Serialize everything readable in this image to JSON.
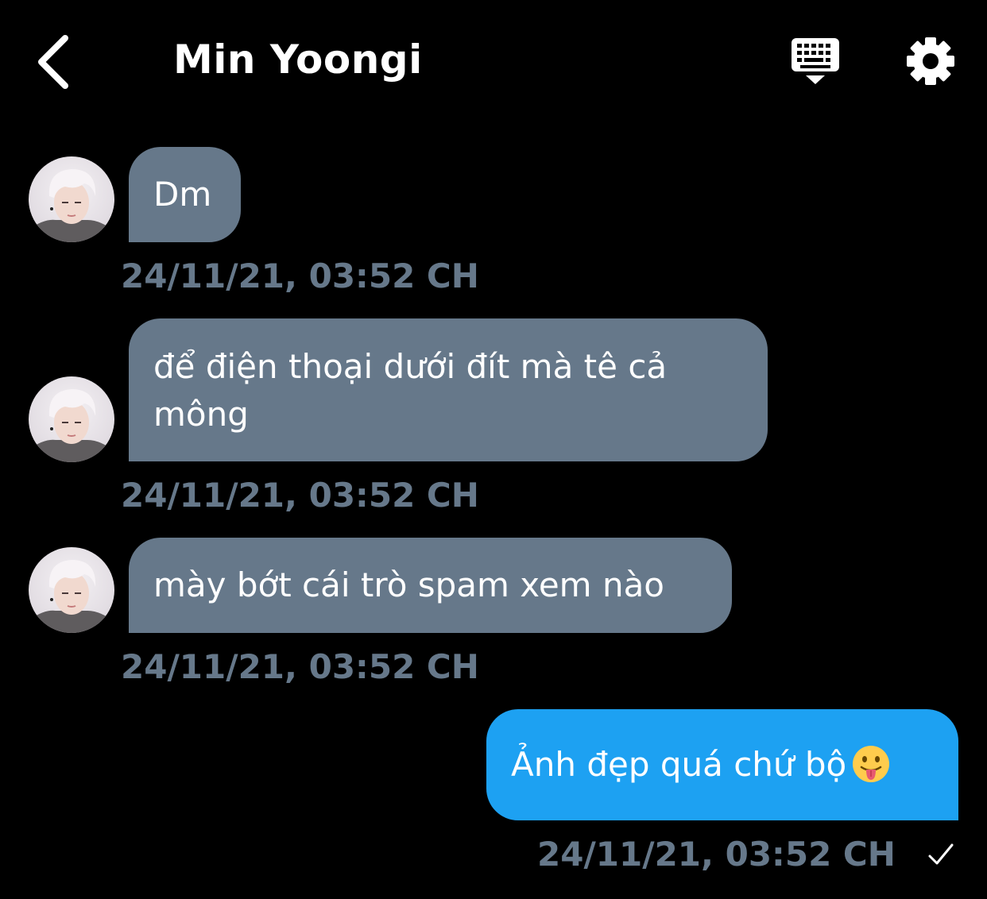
{
  "header": {
    "title": "Min Yoongi",
    "back_icon": "chevron-left-icon",
    "keyboard_icon": "keyboard-hide-icon",
    "settings_icon": "gear-icon"
  },
  "colors": {
    "background": "#000000",
    "incoming_bubble": "#66788a",
    "outgoing_bubble": "#1da1f2",
    "timestamp": "#66788a"
  },
  "messages": [
    {
      "direction": "incoming",
      "lines": [
        "Dm"
      ],
      "timestamp": "24/11/21, 03:52 CH"
    },
    {
      "direction": "incoming",
      "lines": [
        "để điện thoại dưới đít mà tê cả",
        "mông"
      ],
      "timestamp": "24/11/21, 03:52 CH"
    },
    {
      "direction": "incoming",
      "lines": [
        "mày bớt cái trò spam xem nào"
      ],
      "timestamp": "24/11/21, 03:52 CH"
    },
    {
      "direction": "outgoing",
      "lines": [
        "Ảnh đẹp quá chứ bộ"
      ],
      "emoji": "face-with-tongue-emoji",
      "timestamp": "24/11/21, 03:52 CH",
      "status_icon": "checkmark-icon"
    }
  ]
}
